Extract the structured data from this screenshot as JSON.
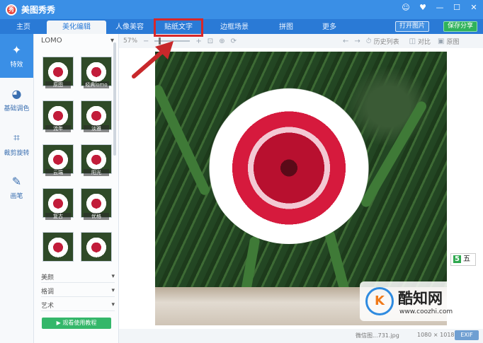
{
  "app": {
    "title": "美图秀秀",
    "logo_text": "秀"
  },
  "window_controls": [
    "☺",
    "♥",
    "—",
    "☐",
    "✕"
  ],
  "tabs": [
    {
      "label": "主页",
      "active": false
    },
    {
      "label": "美化编辑",
      "active": true
    },
    {
      "label": "人像美容",
      "active": false
    },
    {
      "label": "贴纸文字",
      "active": false
    },
    {
      "label": "边框场景",
      "active": false
    },
    {
      "label": "拼图",
      "active": false
    },
    {
      "label": "更多",
      "active": false
    }
  ],
  "header_buttons": {
    "open": "打开图片",
    "save": "保存分享"
  },
  "rail": [
    {
      "label": "特效",
      "icon": "magic-wand-icon",
      "glyph": "✦",
      "active": true
    },
    {
      "label": "基础调色",
      "icon": "palette-icon",
      "glyph": "◕",
      "active": false
    },
    {
      "label": "裁剪旋转",
      "icon": "crop-icon",
      "glyph": "⌗",
      "active": false
    },
    {
      "label": "画笔",
      "icon": "brush-icon",
      "glyph": "✎",
      "active": false
    }
  ],
  "panel": {
    "category": "LOMO",
    "effects": [
      "原图",
      "经典lomo",
      "流年",
      "淡雅",
      "云端",
      "阳光",
      "复古",
      "优格",
      "",
      ""
    ],
    "sections": [
      "美颜",
      "格调",
      "艺术"
    ],
    "tutorial": "观看使用教程"
  },
  "toolbar": {
    "zoom": "57%",
    "history": "历史列表",
    "compare": "对比",
    "original": "原图"
  },
  "status": {
    "filename": "微信图...731.jpg",
    "dimensions": "1080 × 1018",
    "exif": "EXIF"
  },
  "ime_badge": {
    "logo": "5",
    "text": "五"
  },
  "watermark": {
    "logo": "K",
    "name": "酷知网",
    "url": "www.coozhi.com"
  }
}
